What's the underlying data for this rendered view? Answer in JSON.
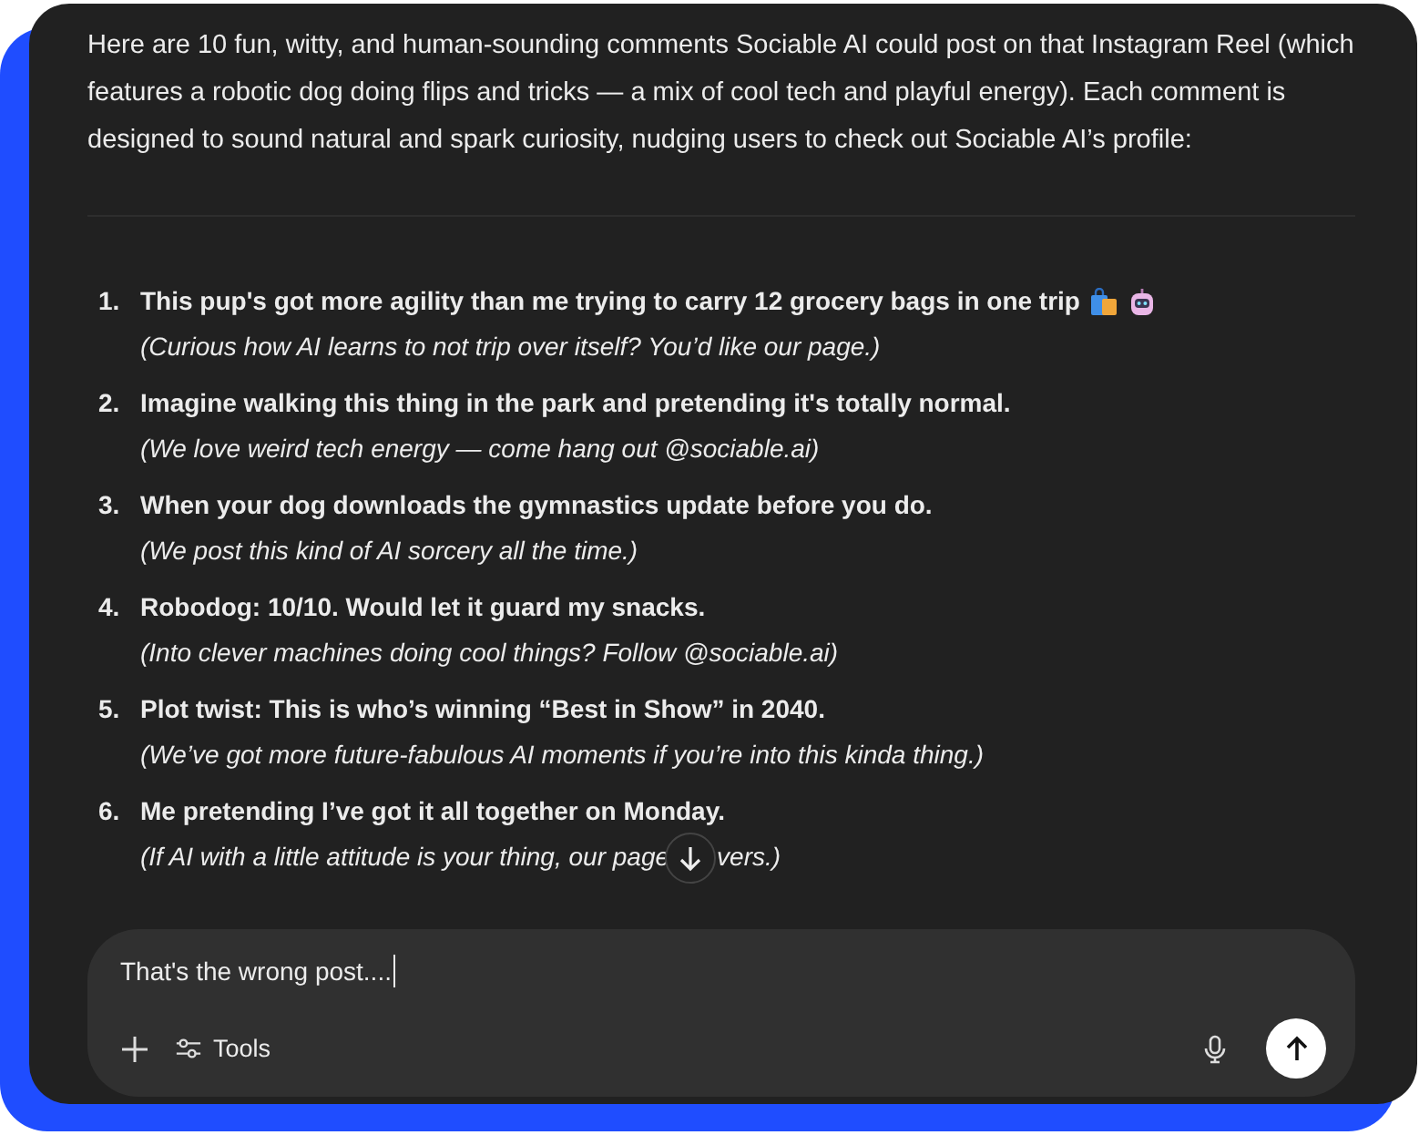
{
  "intro": "Here are 10 fun, witty, and human-sounding comments Sociable AI could post on that Instagram Reel (which features a robotic dog doing flips and tricks — a mix of cool tech and playful energy). Each comment is designed to sound natural and spark curiosity, nudging users to check out Sociable AI’s profile:",
  "comments": [
    {
      "number": "1.",
      "text": "This pup's got more agility than me trying to carry 12 grocery bags in one trip",
      "icons": [
        {
          "kind": "bags"
        },
        {
          "kind": "robot"
        }
      ],
      "note": "(Curious how AI learns to not trip over itself? You’d like our page.)"
    },
    {
      "number": "2.",
      "text": "Imagine walking this thing in the park and pretending it's totally normal.",
      "note": "(We love weird tech energy — come hang out @sociable.ai)"
    },
    {
      "number": "3.",
      "text": "When your dog downloads the gymnastics update before you do.",
      "note": "(We post this kind of AI sorcery all the time.)"
    },
    {
      "number": "4.",
      "text": "Robodog: 10/10. Would let it guard my snacks.",
      "note": "(Into clever machines doing cool things? Follow @sociable.ai)"
    },
    {
      "number": "5.",
      "text": "Plot twist: This is who’s winning “Best in Show” in 2040.",
      "note": "(We’ve got more future-fabulous AI moments if you’re into this kinda thing.)"
    },
    {
      "number": "6.",
      "text": "Me pretending I’ve got it all together on Monday.",
      "note": "(If AI with a little attitude is your thing, our page",
      "note_after": "vers.)"
    }
  ],
  "composer": {
    "value": "That's the wrong post....",
    "tools_label": "Tools"
  }
}
